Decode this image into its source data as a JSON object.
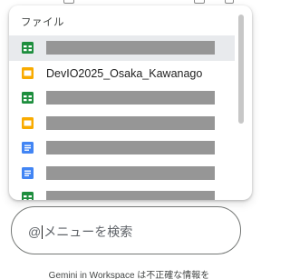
{
  "menu": {
    "section_label": "ファイル",
    "items": [
      {
        "type": "sheets",
        "name": "",
        "redacted": true,
        "hovered": true
      },
      {
        "type": "slides",
        "name": "DevIO2025_Osaka_Kawanago",
        "redacted": false
      },
      {
        "type": "sheets",
        "name": "",
        "redacted": true
      },
      {
        "type": "slides",
        "name": "",
        "redacted": true
      },
      {
        "type": "docs",
        "name": "",
        "redacted": true
      },
      {
        "type": "docs",
        "name": "",
        "redacted": true
      },
      {
        "type": "sheets",
        "name": "",
        "redacted": true
      }
    ]
  },
  "search": {
    "at_sign": "@",
    "placeholder": "メニューを検索"
  },
  "footer": {
    "disclaimer": "Gemini in Workspace は不正確な情報を"
  },
  "colors": {
    "sheets": "#1e8e3e",
    "slides": "#f9ab00",
    "docs": "#4285f4",
    "redaction": "#969696",
    "hover": "#e8eaed"
  }
}
